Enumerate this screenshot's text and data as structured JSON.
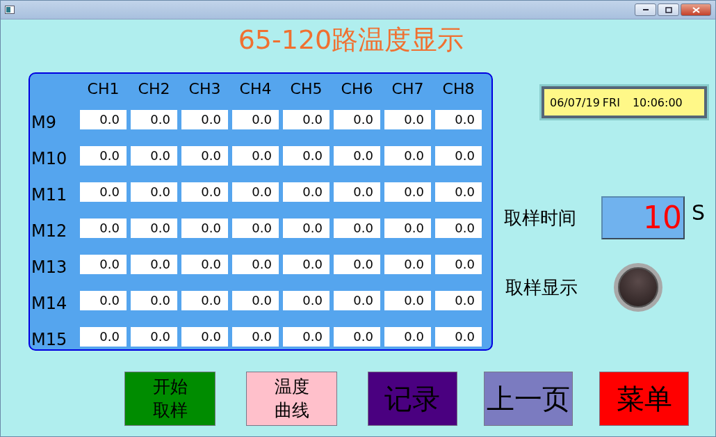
{
  "title": "65-120路温度显示",
  "table": {
    "columns": [
      "CH1",
      "CH2",
      "CH3",
      "CH4",
      "CH5",
      "CH6",
      "CH7",
      "CH8"
    ],
    "rows": [
      {
        "label": "M9",
        "values": [
          "0.0",
          "0.0",
          "0.0",
          "0.0",
          "0.0",
          "0.0",
          "0.0",
          "0.0"
        ]
      },
      {
        "label": "M10",
        "values": [
          "0.0",
          "0.0",
          "0.0",
          "0.0",
          "0.0",
          "0.0",
          "0.0",
          "0.0"
        ]
      },
      {
        "label": "M11",
        "values": [
          "0.0",
          "0.0",
          "0.0",
          "0.0",
          "0.0",
          "0.0",
          "0.0",
          "0.0"
        ]
      },
      {
        "label": "M12",
        "values": [
          "0.0",
          "0.0",
          "0.0",
          "0.0",
          "0.0",
          "0.0",
          "0.0",
          "0.0"
        ]
      },
      {
        "label": "M13",
        "values": [
          "0.0",
          "0.0",
          "0.0",
          "0.0",
          "0.0",
          "0.0",
          "0.0",
          "0.0"
        ]
      },
      {
        "label": "M14",
        "values": [
          "0.0",
          "0.0",
          "0.0",
          "0.0",
          "0.0",
          "0.0",
          "0.0",
          "0.0"
        ]
      },
      {
        "label": "M15",
        "values": [
          "0.0",
          "0.0",
          "0.0",
          "0.0",
          "0.0",
          "0.0",
          "0.0",
          "0.0"
        ]
      }
    ]
  },
  "datetime": {
    "date": "06/07/19",
    "weekday": "FRI",
    "time": "10:06:00"
  },
  "sample_time": {
    "label": "取样时间",
    "value": "10",
    "unit": "S"
  },
  "sample_display": {
    "label": "取样显示",
    "on": false
  },
  "buttons": [
    {
      "label": "开始取样",
      "color": "#008c00",
      "kind": "stacked"
    },
    {
      "label": "温度曲线",
      "color": "#ffc0cb",
      "kind": "stacked"
    },
    {
      "label": "记录",
      "color": "#4a0080",
      "kind": "plain"
    },
    {
      "label": "上一页",
      "color": "#7b7bc0",
      "kind": "plain"
    },
    {
      "label": "菜单",
      "color": "#ff0000",
      "kind": "plain"
    }
  ]
}
